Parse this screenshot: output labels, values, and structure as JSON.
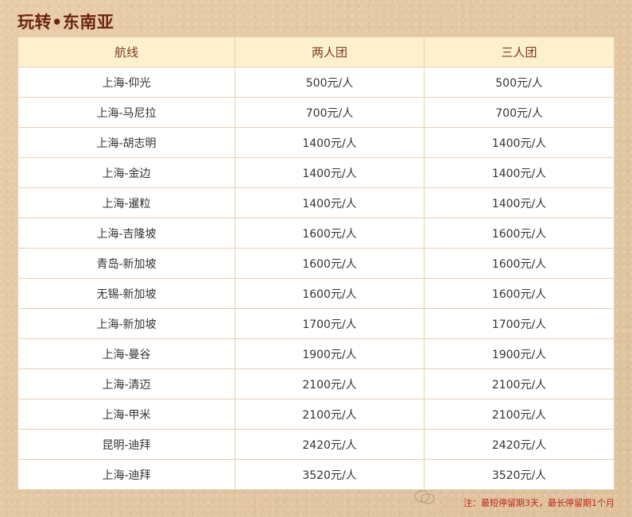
{
  "title": "玩转•东南亚",
  "table": {
    "headers": [
      "航线",
      "两人团",
      "三人团"
    ],
    "rows": [
      [
        "上海-仰光",
        "500元/人",
        "500元/人"
      ],
      [
        "上海-马尼拉",
        "700元/人",
        "700元/人"
      ],
      [
        "上海-胡志明",
        "1400元/人",
        "1400元/人"
      ],
      [
        "上海-金边",
        "1400元/人",
        "1400元/人"
      ],
      [
        "上海-暹粒",
        "1400元/人",
        "1400元/人"
      ],
      [
        "上海-吉隆坡",
        "1600元/人",
        "1600元/人"
      ],
      [
        "青岛-新加坡",
        "1600元/人",
        "1600元/人"
      ],
      [
        "无锡-新加坡",
        "1600元/人",
        "1600元/人"
      ],
      [
        "上海-新加坡",
        "1700元/人",
        "1700元/人"
      ],
      [
        "上海-曼谷",
        "1900元/人",
        "1900元/人"
      ],
      [
        "上海-清迈",
        "2100元/人",
        "2100元/人"
      ],
      [
        "上海-甲米",
        "2100元/人",
        "2100元/人"
      ],
      [
        "昆明-迪拜",
        "2420元/人",
        "2420元/人"
      ],
      [
        "上海-迪拜",
        "3520元/人",
        "3520元/人"
      ]
    ]
  },
  "note": "注：最短停留期3天，最长停留期1个月",
  "colors": {
    "title": "#6b2312",
    "header_bg": "#fdf0cf",
    "header_text": "#7b3a1c",
    "border": "#e8d2b0",
    "note": "#c0271b",
    "background": "#e7c9a3"
  },
  "icons": {
    "watermark": "wechat-watermark-icon"
  }
}
